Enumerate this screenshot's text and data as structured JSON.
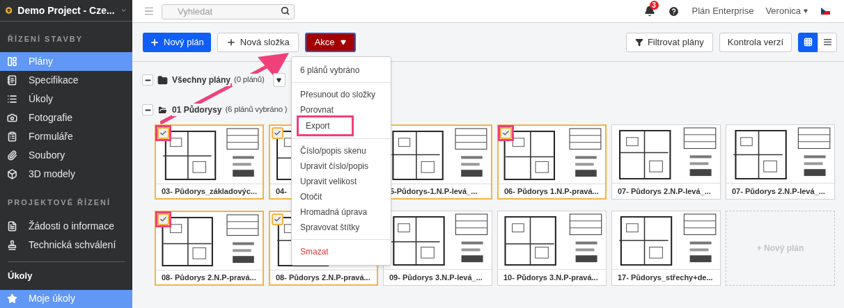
{
  "project": {
    "name": "Demo Project - Cze..."
  },
  "sidebar": {
    "sections": [
      {
        "title": "ŘÍZENÍ STAVBY",
        "items": [
          {
            "label": "Plány",
            "selected": true
          },
          {
            "label": "Specifikace",
            "selected": false
          },
          {
            "label": "Úkoly",
            "selected": false
          },
          {
            "label": "Fotografie",
            "selected": false
          },
          {
            "label": "Formuláře",
            "selected": false
          },
          {
            "label": "Soubory",
            "selected": false
          },
          {
            "label": "3D modely",
            "selected": false
          }
        ]
      },
      {
        "title": "PROJEKTOVÉ ŘÍZENÍ",
        "items": [
          {
            "label": "Žádosti o informace",
            "selected": false
          },
          {
            "label": "Technická schválení",
            "selected": false
          }
        ]
      }
    ],
    "tasks": {
      "title": "Úkoly",
      "items": [
        {
          "label": "Moje úkoly",
          "selected": true
        }
      ]
    }
  },
  "header": {
    "search": {
      "placeholder": "Vyhledat"
    },
    "notifications": "3",
    "plan": "Plán Enterprise",
    "user": "Veronica"
  },
  "toolbar": {
    "new_plan": "Nový plán",
    "new_folder": "Nová složka",
    "actions": "Akce",
    "filter": "Filtrovat plány",
    "versions": "Kontrola verzí",
    "view": [
      {
        "kind": "grid",
        "selected": true
      },
      {
        "kind": "list",
        "selected": false
      }
    ]
  },
  "folders": [
    {
      "name": "Všechny plány",
      "count": "(0 plánů)"
    },
    {
      "name": "01 Půdorysy",
      "count": "(6 plánů vybráno )"
    }
  ],
  "cards": [
    {
      "label": "03- Půdorys_základovýc...",
      "selected": true,
      "checkbox": {
        "checked": true,
        "annotated": true
      }
    },
    {
      "label": "04-",
      "selected": true,
      "checkbox": {
        "checked": true,
        "annotated": false
      }
    },
    {
      "label": "5-Půdorys-1.N.P-levá_...",
      "selected": true
    },
    {
      "label": "06- Půdorys 1.N.P-pravá...",
      "selected": true,
      "checkbox": {
        "checked": true,
        "annotated": true
      }
    },
    {
      "label": "07- Půdorys 2.N.P-levá_...",
      "selected": false
    },
    {
      "label": "07- Půdorys 2.N.P-levá_...",
      "selected": false
    },
    {
      "label": "08- Půdorys 2.N.P-pravá...",
      "selected": true,
      "checkbox": {
        "checked": true,
        "annotated": true
      }
    },
    {
      "label": "08- Půdorys 2.N.P-pravá...",
      "selected": true,
      "checkbox": {
        "checked": true,
        "annotated": false
      }
    },
    {
      "label": "09- Půdorys 3.N.P-levá_...",
      "selected": false
    },
    {
      "label": "10- Půdorys 3.N.P-pravá...",
      "selected": false
    },
    {
      "label": "17- Půdorys_střechy+de...",
      "selected": false
    }
  ],
  "add_card": "+ Nový plán",
  "menu": {
    "groups": [
      [
        {
          "label": "6 plánů vybráno",
          "kind": "info",
          "highlighted": false
        }
      ],
      [
        {
          "label": "Přesunout do složky",
          "kind": "action",
          "highlighted": false
        },
        {
          "label": "Porovnat",
          "kind": "action",
          "highlighted": false
        },
        {
          "label": "Export",
          "kind": "action",
          "highlighted": true
        }
      ],
      [
        {
          "label": "Číslo/popis skenu",
          "kind": "action",
          "highlighted": false
        },
        {
          "label": "Upravit číslo/popis",
          "kind": "action",
          "highlighted": false
        },
        {
          "label": "Upravit velikost",
          "kind": "action",
          "highlighted": false
        },
        {
          "label": "Otočit",
          "kind": "action",
          "highlighted": false
        },
        {
          "label": "Hromadná úprava",
          "kind": "action",
          "highlighted": false
        },
        {
          "label": "Spravovat štítky",
          "kind": "action",
          "highlighted": false
        }
      ],
      [
        {
          "label": "Smazat",
          "kind": "danger",
          "highlighted": false
        }
      ]
    ]
  }
}
